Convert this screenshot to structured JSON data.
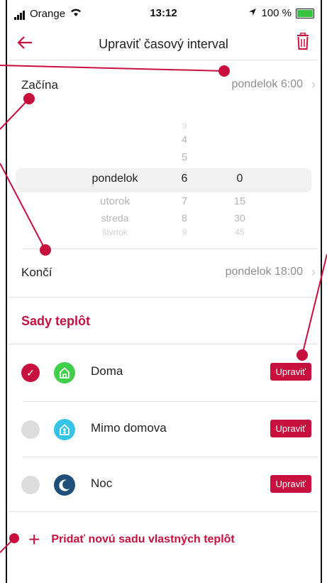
{
  "status_bar": {
    "carrier": "Orange",
    "time": "13:12",
    "battery": "100 %"
  },
  "nav": {
    "title": "Upraviť časový interval"
  },
  "start": {
    "label": "Začína",
    "value": "pondelok 6:00"
  },
  "picker": {
    "days": [
      "pondelok",
      "utorok",
      "streda",
      "štvrtok"
    ],
    "hours": [
      "3",
      "4",
      "5",
      "6",
      "7",
      "8",
      "9"
    ],
    "minutes": [
      "0",
      "15",
      "30",
      "45"
    ]
  },
  "end": {
    "label": "Končí",
    "value": "pondelok 18:00"
  },
  "section_title": "Sady teplôt",
  "sets": [
    {
      "name": "Doma",
      "checked": true,
      "edit": "Upraviť",
      "icon": "home-icon",
      "color": "#3fcf4b"
    },
    {
      "name": "Mimo domova",
      "checked": false,
      "edit": "Upraviť",
      "icon": "away-icon",
      "color": "#35c3e6"
    },
    {
      "name": "Noc",
      "checked": false,
      "edit": "Upraviť",
      "icon": "moon-icon",
      "color": "#1f4e79"
    }
  ],
  "add_label": "Pridať novú sadu vlastných teplôt",
  "colors": {
    "accent": "#c8103e"
  }
}
